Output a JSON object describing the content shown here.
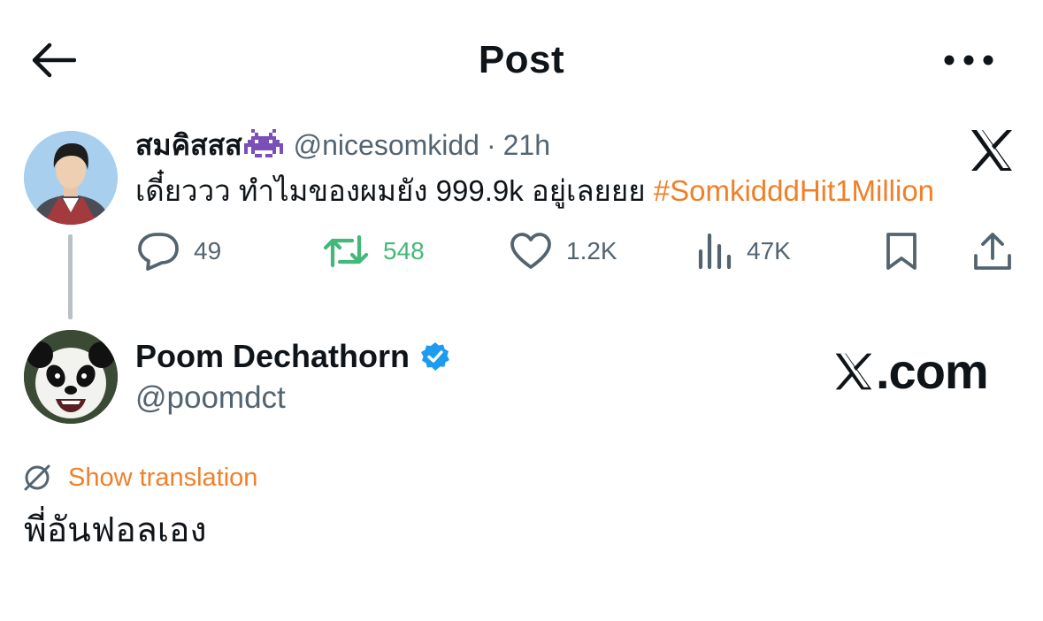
{
  "header": {
    "title": "Post",
    "back_icon": "arrow-left-icon",
    "more_icon": "more-horizontal-icon"
  },
  "quoted_post": {
    "name": "สมคิสสส",
    "name_emoji": "alien-monster-emoji",
    "handle": "@nicesomkidd",
    "separator": "·",
    "time": "21h",
    "text": "เดี๋ยววว ทำไมของผมยัง 999.9k อยู่เลยยย",
    "hashtag": "#SomkidddHit1Million",
    "source_logo": "x-logo-icon",
    "actions": {
      "replies": "49",
      "reposts": "548",
      "likes": "1.2K",
      "views": "47K"
    }
  },
  "post": {
    "author_name": "Poom Dechathorn",
    "author_handle": "@poomdct",
    "verified": true,
    "translate_label": "Show translation",
    "body": "พี่อันฟอลเอง"
  },
  "watermark": {
    "suffix": ".com"
  },
  "colors": {
    "accent": "#f07f28",
    "repost": "#44b879",
    "muted": "#536471",
    "verified": "#1d9bf0",
    "text": "#0f1419"
  }
}
